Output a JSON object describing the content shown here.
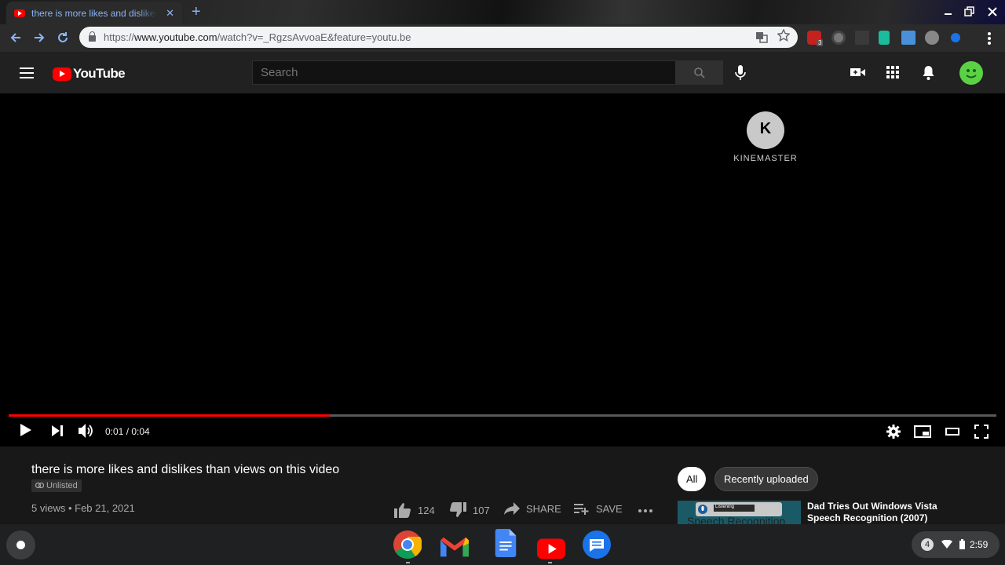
{
  "browser": {
    "tab_title": "there is more likes and dislikes than views on this video - YouTube",
    "tab_close": "✕",
    "new_tab": "+",
    "url_scheme": "https://",
    "url_host": "www.youtube.com",
    "url_path": "/watch?v=_RgzsAvvoaE&feature=youtu.be",
    "extension_badge": "3"
  },
  "youtube": {
    "logo_text": "YouTube",
    "search_placeholder": "Search"
  },
  "player": {
    "watermark": "KINEMASTER",
    "time_display": "0:01 / 0:04",
    "progress_fraction": 0.325
  },
  "video": {
    "title": "there is more likes and dislikes than views on this video",
    "visibility_badge": "Unlisted",
    "views_date": "5 views • Feb 21, 2021",
    "likes": "124",
    "dislikes": "107",
    "share_label": "SHARE",
    "save_label": "SAVE"
  },
  "sidebar": {
    "chips": [
      "All",
      "Recently uploaded"
    ],
    "recommendation_title": "Dad Tries Out Windows Vista Speech Recognition (2007)",
    "thumb_text": "Speech Recognition",
    "thumb_small": "Listening"
  },
  "shelf": {
    "notification_count": "4",
    "clock": "2:59"
  },
  "colors": {
    "accent_blue": "#8ab4f8",
    "youtube_red": "#ff0000"
  }
}
